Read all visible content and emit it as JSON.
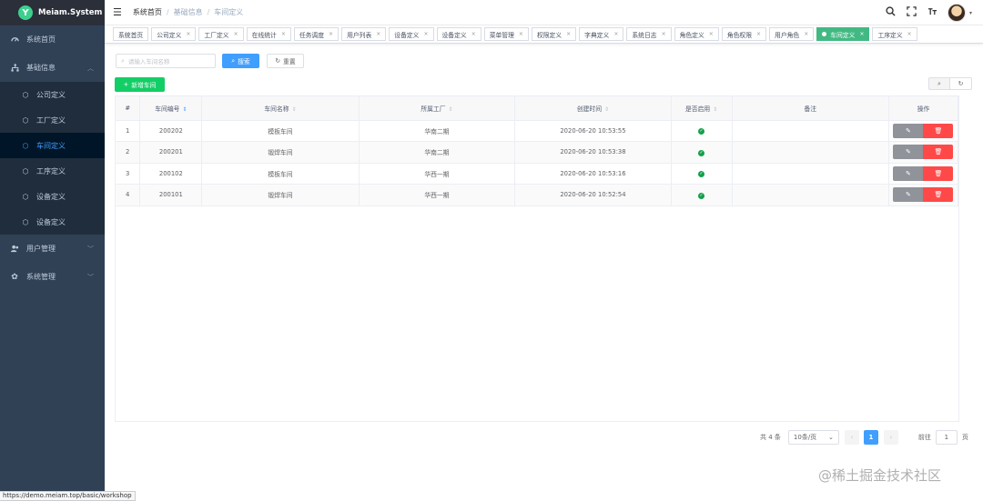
{
  "app": {
    "logo_letter": "Y",
    "title": "Meiam.System"
  },
  "sidebar": {
    "items": [
      {
        "label": "系统首页",
        "icon": "dashboard-icon"
      },
      {
        "label": "基础信息",
        "icon": "tree-icon",
        "expanded": true
      },
      {
        "label": "用户管理",
        "icon": "users-icon"
      },
      {
        "label": "系统管理",
        "icon": "gear-icon"
      }
    ],
    "sub_items": [
      {
        "label": "公司定义"
      },
      {
        "label": "工厂定义"
      },
      {
        "label": "车间定义",
        "active": true
      },
      {
        "label": "工序定义"
      },
      {
        "label": "设备定义"
      },
      {
        "label": "设备定义"
      }
    ]
  },
  "status_url": "https://demo.meiam.top/basic/workshop",
  "breadcrumb": [
    "系统首页",
    "基础信息",
    "车间定义"
  ],
  "tags": [
    {
      "label": "系统首页",
      "closable": false
    },
    {
      "label": "公司定义",
      "closable": true
    },
    {
      "label": "工厂定义",
      "closable": true
    },
    {
      "label": "在线统计",
      "closable": true
    },
    {
      "label": "任务调度",
      "closable": true
    },
    {
      "label": "用户列表",
      "closable": true
    },
    {
      "label": "设备定义",
      "closable": true
    },
    {
      "label": "设备定义",
      "closable": true
    },
    {
      "label": "菜单管理",
      "closable": true
    },
    {
      "label": "权限定义",
      "closable": true
    },
    {
      "label": "字典定义",
      "closable": true
    },
    {
      "label": "系统日志",
      "closable": true
    },
    {
      "label": "角色定义",
      "closable": true
    },
    {
      "label": "角色权限",
      "closable": true
    },
    {
      "label": "用户角色",
      "closable": true
    },
    {
      "label": "车间定义",
      "closable": true,
      "active": true
    },
    {
      "label": "工序定义",
      "closable": true
    }
  ],
  "search": {
    "placeholder": "请输入车间名称",
    "search_label": "搜索",
    "reset_label": "重置"
  },
  "add_label": "新增车间",
  "table": {
    "headers": [
      "#",
      "车间编号",
      "车间名称",
      "所属工厂",
      "创建时间",
      "是否启用",
      "备注",
      "操作"
    ],
    "rows": [
      {
        "index": "1",
        "code": "200202",
        "name": "模板车间",
        "factory": "华南二期",
        "created": "2020-06-20 10:53:55",
        "enabled": true,
        "remark": ""
      },
      {
        "index": "2",
        "code": "200201",
        "name": "锻焊车间",
        "factory": "华南二期",
        "created": "2020-06-20 10:53:38",
        "enabled": true,
        "remark": ""
      },
      {
        "index": "3",
        "code": "200102",
        "name": "模板车间",
        "factory": "华西一期",
        "created": "2020-06-20 10:53:16",
        "enabled": true,
        "remark": ""
      },
      {
        "index": "4",
        "code": "200101",
        "name": "锻焊车间",
        "factory": "华西一期",
        "created": "2020-06-20 10:52:54",
        "enabled": true,
        "remark": ""
      }
    ]
  },
  "pagination": {
    "total": "共 4 条",
    "page_size": "10条/页",
    "current": "1",
    "goto_label": "前往",
    "goto_value": "1",
    "page_suffix": "页"
  },
  "watermark": "@稀土掘金技术社区",
  "colors": {
    "sidebar": "#304156",
    "primary": "#409eff",
    "success": "#13ce66",
    "danger": "#ff4949",
    "tag_active": "#42b983"
  }
}
